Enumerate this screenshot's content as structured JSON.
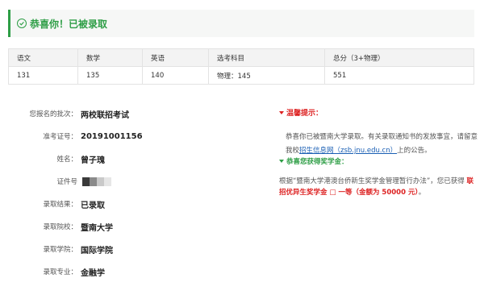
{
  "banner": {
    "title": "恭喜你！已被录取",
    "icon": "check-circle-icon",
    "accent": "#2e9e46"
  },
  "scores": {
    "headers": [
      "语文",
      "数学",
      "英语",
      "选考科目",
      "总分（3+物理）"
    ],
    "values": [
      "131",
      "135",
      "140",
      "物理：145",
      "551"
    ]
  },
  "info": {
    "batch_label": "您报名的批次：",
    "batch_value": "两校联招考试",
    "exam_label": "准考证号：",
    "exam_value": "20191001156",
    "name_label": "姓名：",
    "name_value": "曾子瑰",
    "id_label": "证件号",
    "result_label": "录取结果：",
    "result_value": "已录取",
    "school_label": "录取院校：",
    "school_value": "暨南大学",
    "college_label": "录取学院：",
    "college_value": "国际学院",
    "major_label": "录取专业：",
    "major_value": "金融学"
  },
  "notice": {
    "title": "温馨提示：",
    "para_prefix": "恭喜你已被暨南大学录取。有关录取通知书的发放事宜，请留意我校",
    "link_text": "招生信息网（zsb.jnu.edu.cn）",
    "para_suffix": "上的公告。",
    "scholarship_title": "恭喜您获得奖学金：",
    "scholarship_prefix": "根据“暨南大学港澳台侨新生奖学金管理暂行办法”，您已获得",
    "scholarship_highlight": "联招优异生奖学金 □ 一等（金额为 50000 元）",
    "scholarship_suffix": "。"
  }
}
